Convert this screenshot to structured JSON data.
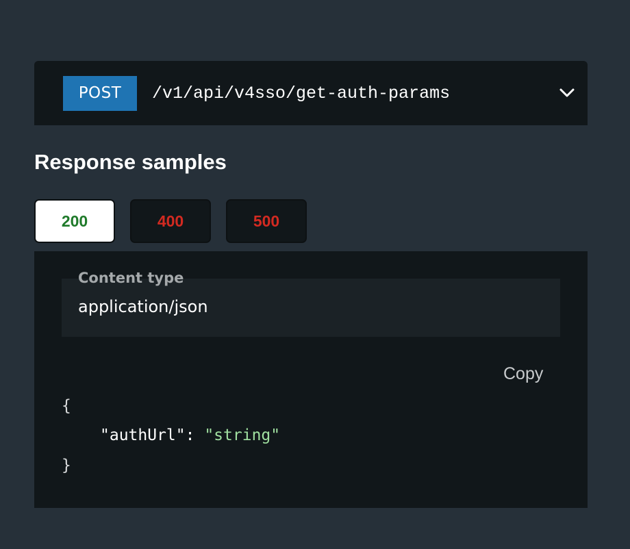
{
  "endpoint": {
    "method": "POST",
    "path": "/v1/api/v4sso/get-auth-params",
    "toggle_icon": "chevron-down-icon"
  },
  "section": {
    "title": "Response samples"
  },
  "tabs": [
    {
      "label": "200",
      "selected": true,
      "color": "#1f7a2a"
    },
    {
      "label": "400",
      "selected": false,
      "color": "#d32a21"
    },
    {
      "label": "500",
      "selected": false,
      "color": "#d32a21"
    }
  ],
  "content_type": {
    "label": "Content type",
    "value": "application/json"
  },
  "copy_label": "Copy",
  "code": {
    "open_brace": "{",
    "key": "\"authUrl\"",
    "colon": ": ",
    "value": "\"string\"",
    "close_brace": "}"
  },
  "colors": {
    "background": "#263039",
    "panel": "#11171a",
    "method_badge": "#1f74b3",
    "success": "#1f7a2a",
    "error": "#d32a21",
    "json_string": "#a0e0a0"
  }
}
